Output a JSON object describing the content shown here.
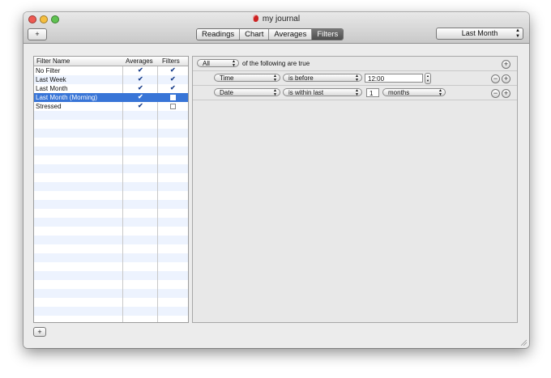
{
  "window": {
    "title": "my journal"
  },
  "toolbar": {
    "add_label": "+",
    "tabs": [
      {
        "label": "Readings",
        "active": false
      },
      {
        "label": "Chart",
        "active": false
      },
      {
        "label": "Averages",
        "active": false
      },
      {
        "label": "Filters",
        "active": true
      }
    ],
    "range_popup": "Last Month"
  },
  "filter_table": {
    "columns": [
      "Filter Name",
      "Averages",
      "Filters"
    ],
    "rows": [
      {
        "name": "No Filter",
        "averages": true,
        "filters": true,
        "selected": false
      },
      {
        "name": "Last Week",
        "averages": true,
        "filters": true,
        "selected": false
      },
      {
        "name": "Last Month",
        "averages": true,
        "filters": true,
        "selected": false
      },
      {
        "name": "Last Month (Morning)",
        "averages": true,
        "filters": false,
        "selected": true
      },
      {
        "name": "Stressed",
        "averages": true,
        "filters": false,
        "selected": false
      }
    ],
    "add_label": "+"
  },
  "predicate_editor": {
    "match_popup": "All",
    "match_text": "of the following are true",
    "rows": [
      {
        "field": "Time",
        "operator": "is before",
        "value": "12:00"
      },
      {
        "field": "Date",
        "operator": "is within last",
        "value": "1",
        "unit": "months"
      }
    ],
    "remove_label": "−",
    "add_label": "+"
  },
  "colors": {
    "selection": "#3875d7",
    "row_stripe": "#edf3fe",
    "close": "#ee5a52",
    "minimize": "#f5be3f",
    "zoom": "#5fc251",
    "tab_active": "#5c5c5c"
  },
  "icons": {
    "checkbox_checked": "checkmark-icon",
    "app": "journal-drop-icon",
    "stepper": "stepper-arrows-icon"
  }
}
